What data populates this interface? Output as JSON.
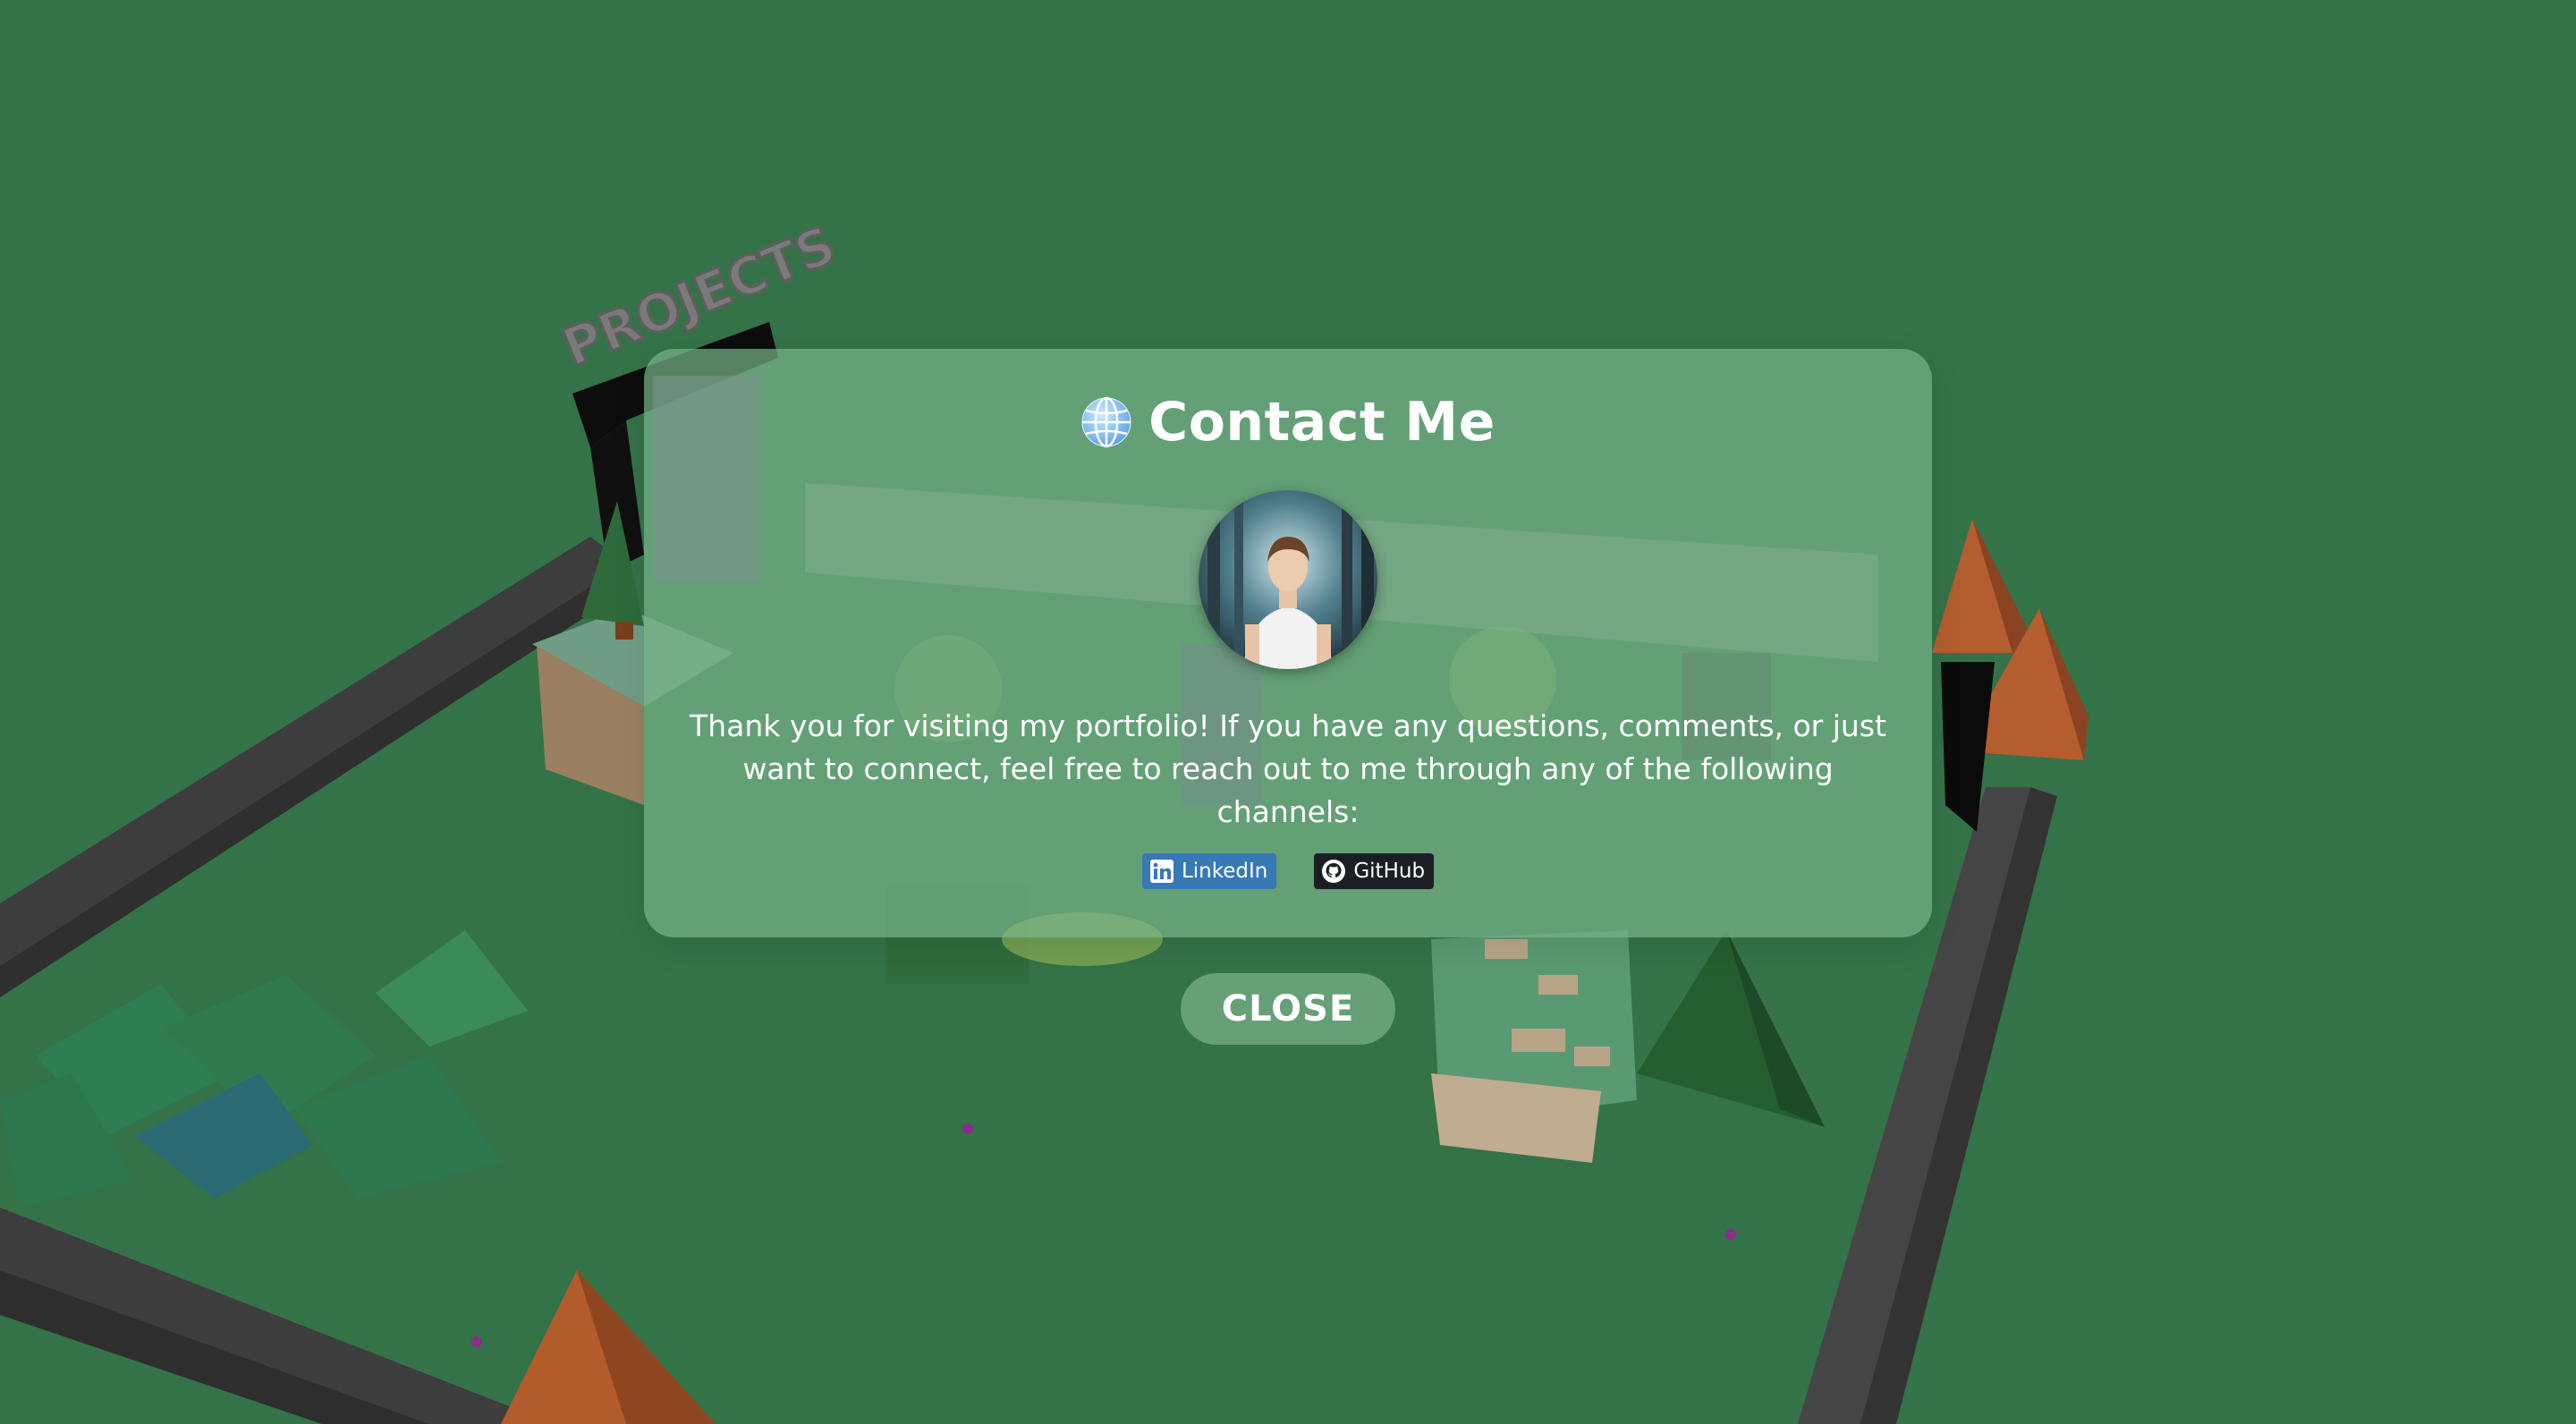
{
  "scene": {
    "sign_text": "PROJECTS",
    "ground_color": "#347247",
    "wall_color": "#3c3c3c",
    "roof_color": "#b05a2c"
  },
  "modal": {
    "icon": "globe-icon",
    "title": "Contact Me",
    "avatar_alt": "profile-photo",
    "message": "Thank you for visiting my portfolio! If you have any questions, comments, or just want to connect, feel free to reach out to me through any of the following channels:",
    "links": [
      {
        "label": "LinkedIn",
        "icon": "linkedin-icon",
        "color": "#3679b5"
      },
      {
        "label": "GitHub",
        "icon": "github-icon",
        "color": "#1b1f23"
      }
    ]
  },
  "close_button": {
    "label": "CLOSE"
  }
}
